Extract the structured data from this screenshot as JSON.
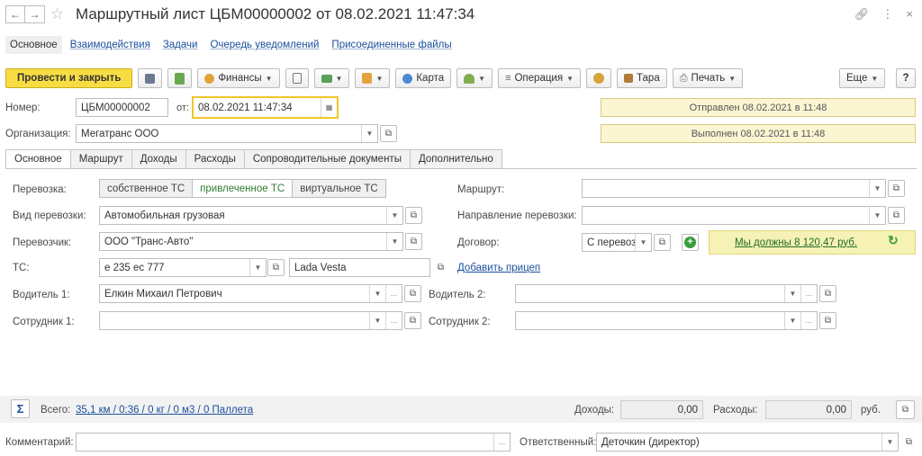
{
  "header": {
    "title": "Маршрутный лист ЦБМ00000002 от 08.02.2021 11:47:34"
  },
  "section_nav": [
    "Основное",
    "Взаимодействия",
    "Задачи",
    "Очередь уведомлений",
    "Присоединенные файлы"
  ],
  "toolbar": {
    "post_close": "Провести и закрыть",
    "finance": "Финансы",
    "map": "Карта",
    "operation": "Операция",
    "tara": "Тара",
    "print": "Печать",
    "more": "Еще",
    "help": "?"
  },
  "doc": {
    "number_label": "Номер:",
    "number": "ЦБМ00000002",
    "date_label": "от:",
    "date": "08.02.2021 11:47:34",
    "org_label": "Организация:",
    "org": "Мегатранс ООО",
    "status_sent": "Отправлен 08.02.2021 в 11:48",
    "status_done": "Выполнен 08.02.2021 в 11:48"
  },
  "tabs": [
    "Основное",
    "Маршрут",
    "Доходы",
    "Расходы",
    "Сопроводительные документы",
    "Дополнительно"
  ],
  "main": {
    "transport_label": "Перевозка:",
    "transport_options": [
      "собственное ТС",
      "привлеченное ТС",
      "виртуальное ТС"
    ],
    "transport_selected": "привлеченное ТС",
    "kind_label": "Вид перевозки:",
    "kind": "Автомобильная грузовая",
    "carrier_label": "Перевозчик:",
    "carrier": "ООО \"Транс-Авто\"",
    "vehicle_label": "ТС:",
    "vehicle": "е 235 ес 777",
    "vehicle_model": "Lada Vesta",
    "add_trailer": "Добавить прицеп",
    "driver1_label": "Водитель 1:",
    "driver1": "Елкин Михаил Петрович",
    "employee1_label": "Сотрудник 1:",
    "employee1": "",
    "route_label": "Маршрут:",
    "route": "",
    "direction_label": "Направление перевозки:",
    "direction": "",
    "contract_label": "Договор:",
    "contract": "С перевозч",
    "debt": "Мы должны 8 120,47 руб.",
    "driver2_label": "Водитель 2:",
    "driver2": "",
    "employee2_label": "Сотрудник 2:",
    "employee2": ""
  },
  "footer": {
    "total_label": "Всего:",
    "total_link": "35,1 км / 0:36 / 0 кг / 0 м3 / 0 Паллета",
    "income_label": "Доходы:",
    "income": "0,00",
    "expenses_label": "Расходы:",
    "expenses": "0,00",
    "currency": "руб."
  },
  "bottom": {
    "comment_label": "Комментарий:",
    "comment": "",
    "responsible_label": "Ответственный:",
    "responsible": "Деточкин (директор)"
  },
  "colors": {
    "primary_button": "#f7dd43",
    "info_bg": "#fbf5d2",
    "link": "#1a4f9c",
    "selected_option": "#2e7d32"
  }
}
